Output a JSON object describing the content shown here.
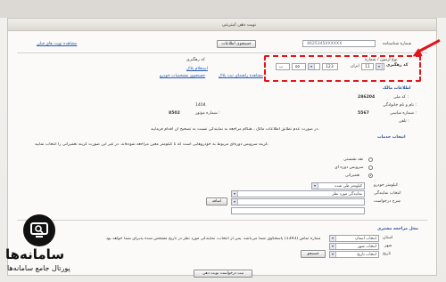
{
  "window": {
    "title": "نوبت دهی اینترنتی"
  },
  "top_nav": {
    "link": "مشاهده نوبت های قبلی"
  },
  "id_section": {
    "national_code_label": "شماره شناسنامه",
    "national_code_value": "4625345XXXXXX",
    "search_button": "جستجوی اطلاعات"
  },
  "registration": {
    "type_label": "نوع آزمون / شماره",
    "code_label": "کد رهگیری",
    "license_label": "ایران",
    "plate_parts": [
      "11",
      "ب",
      "۵۵",
      "123"
    ],
    "help_link": "مشاهده راهنمای ثبت پلاک",
    "link2": "استعلام پلاک",
    "link3": "جستجوی مشخصات خودرو"
  },
  "owner": {
    "section_title": "اطلاعات مالک",
    "national_id_label": "کد ملی :",
    "national_id_value": "286204",
    "name_label": "نام و نام خانوادگی :",
    "name_value": "1404",
    "chassis_label": "شماره شاسی :",
    "chassis_value": "5567",
    "motor_label": "شماره موتور :",
    "motor_value": "8502",
    "phone_label": "تلفن :"
  },
  "notice": "در صورت عدم تطابق اطلاعات مالک ، هنگام مراجعه به نمایندگی نسبت به تصحیح آن اقدام فرمایید.",
  "service": {
    "section_title": "انتخاب خدمات",
    "desc": "گزینه سرویس دوره‌ای مربوط به خودروهایی است که تا کیلومتر معین مراجعه نموده‌اند. در غیر این صورت گزینه تعمیراتی را انتخاب نمایید.",
    "options": [
      "سرویس دوره ای",
      "تعمیراتی",
      "نقد نشستی"
    ],
    "mileage_label": "کیلومتر خودرو",
    "mileage_value": "کیلومتر طی شده",
    "agency_label": "انتخاب نمایندگی",
    "agency_value": "نمایندگی مورد نظر",
    "desc_label": "شرح درخواست",
    "add_button": "اضافه"
  },
  "appointment": {
    "section_title": "محل مراجعه مشتری",
    "province_label": "استان",
    "province_value": "انتخاب استان",
    "city_label": "شهر",
    "city_value": "انتخاب شهر",
    "date_label": "تاریخ",
    "date_value": "انتخاب تاریخ",
    "search_button": "جستجو",
    "footer_note": "جهت ارائه خدمات به مشتریان گرامی شماره تماس (1393) پاسخگوی شما می‌باشد. پس از انتخاب، نمایندگی مورد نظر در تاریخ مشخص شده پذیرای شما خواهد بود."
  },
  "submit_button": "ثبت درخواست نوبت دهی",
  "brand": {
    "name": "سامانه‌ها",
    "tagline": "پورتال جامع سامانه‌ها"
  }
}
